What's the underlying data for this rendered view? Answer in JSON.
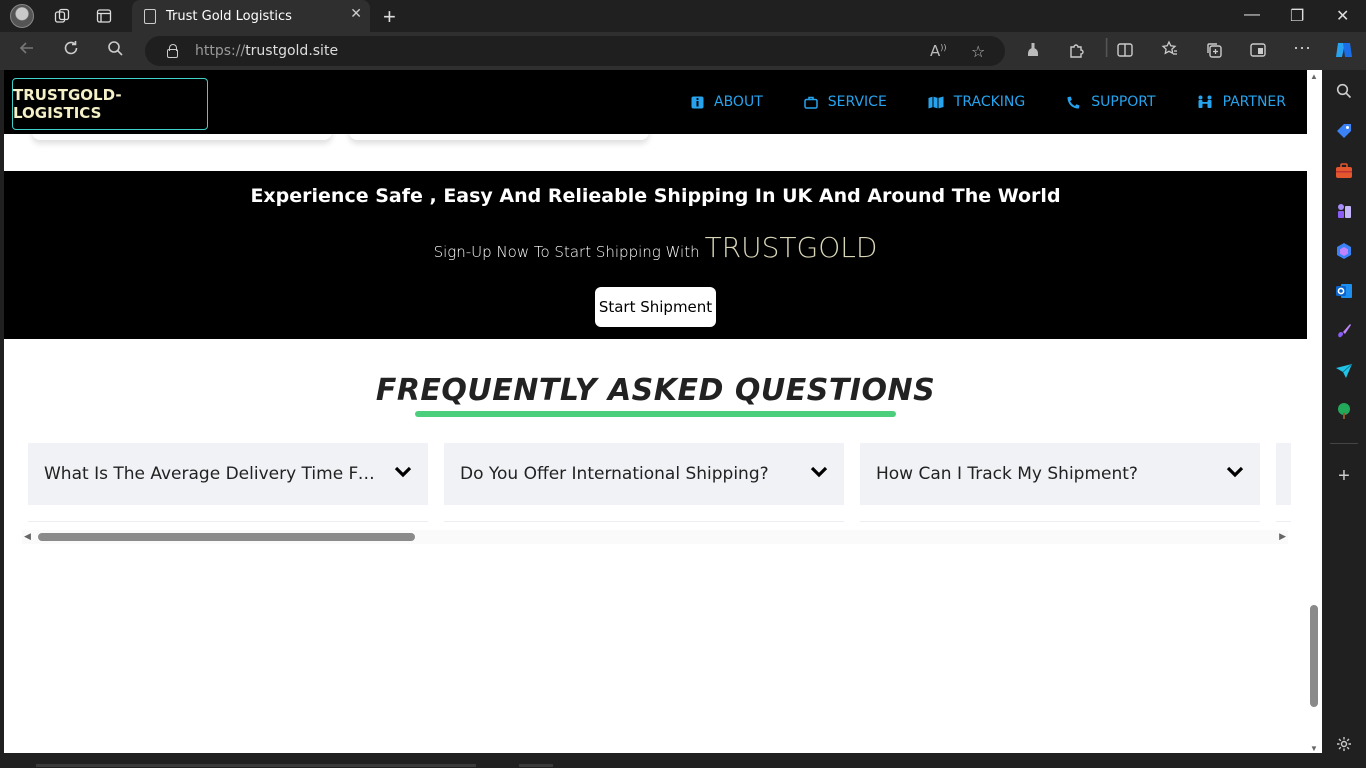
{
  "browser": {
    "tab_title": "Trust Gold Logistics",
    "url_protocol": "https://",
    "url_host": "trustgold.site",
    "read_aloud_label": "A"
  },
  "nav": {
    "logo": "TRUSTGOLD-LOGISTICS",
    "items": [
      {
        "label": "ABOUT",
        "icon": "info-icon"
      },
      {
        "label": "SERVICE",
        "icon": "briefcase-icon"
      },
      {
        "label": "TRACKING",
        "icon": "map-icon"
      },
      {
        "label": "SUPPORT",
        "icon": "phone-icon"
      },
      {
        "label": "PARTNER",
        "icon": "people-icon"
      }
    ],
    "accent": "#27a3ee"
  },
  "cta": {
    "heading": "Experience Safe , Easy And Relieable Shipping In UK And Around The World",
    "sub": "Sign-Up Now To Start Shipping With",
    "brand": "TRUSTGOLD",
    "button": "Start Shipment"
  },
  "faq": {
    "title": "FREQUENTLY ASKED QUESTIONS",
    "underline_color": "#4ccf7d",
    "items": [
      {
        "question": "What Is The Average Delivery Time For Domestic Shipments?"
      },
      {
        "question": "Do You Offer International Shipping?"
      },
      {
        "question": "How Can I Track My Shipment?"
      }
    ]
  }
}
